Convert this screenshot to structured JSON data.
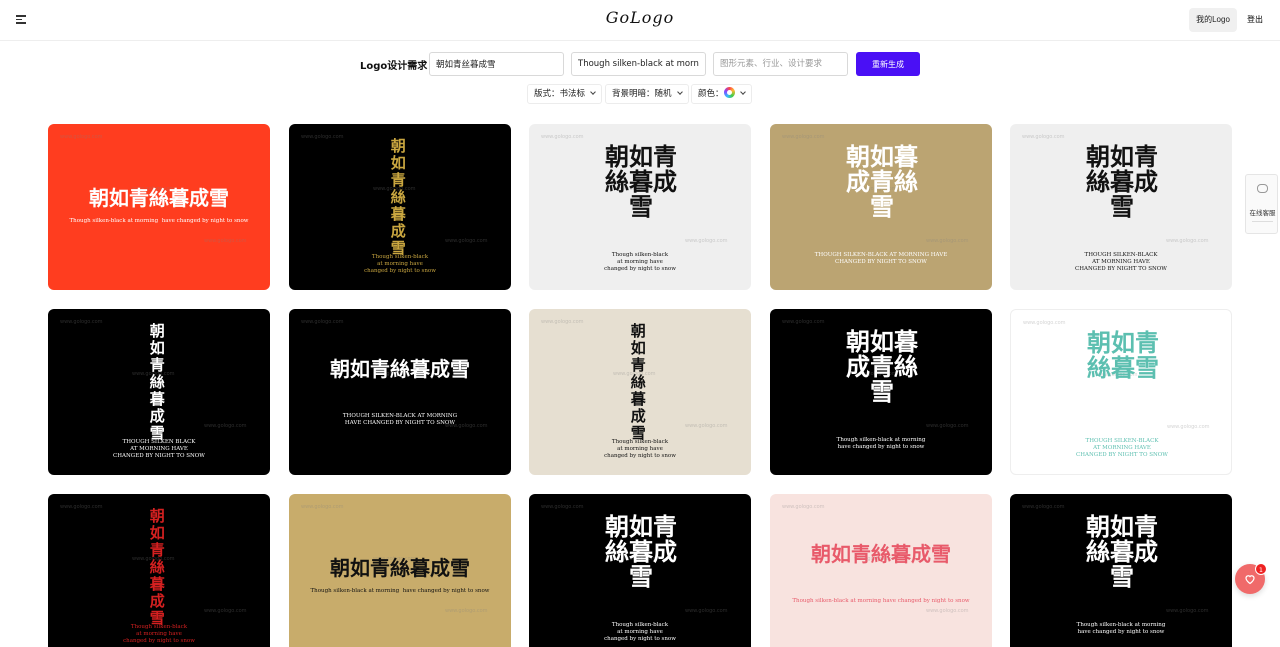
{
  "header": {
    "logo": "GoLogo",
    "my_logo": "我的Logo",
    "logout": "登出"
  },
  "form": {
    "label": "Logo设计需求",
    "name_value": "朝如青丝暮成雪",
    "slogan_value": "Though silken-black at morning h",
    "desc_placeholder": "图形元素、行业、设计要求",
    "regenerate": "重新生成"
  },
  "filters": {
    "layout": "版式：书法标",
    "brightness": "背景明暗：随机",
    "color": "颜色："
  },
  "side_panel": {
    "label": "在线客服"
  },
  "favorites": {
    "count": "1"
  },
  "colors": {
    "accent": "#4a10f5",
    "fav": "#f06a6a"
  },
  "watermark": "www.gologo.com",
  "cards": [
    {
      "bg": "#ff3d1f",
      "fg": "#ffffff",
      "cjk": "朝如青絲暮成雪",
      "eng": "Though silken-black at morning  have changed by night to snow",
      "layout": "h"
    },
    {
      "bg": "#000000",
      "fg": "#c9a640",
      "cjk": "朝如青絲暮成雪",
      "eng": "Though silken-black\nat morning have\nchanged by night to snow",
      "layout": "v"
    },
    {
      "bg": "#efefef",
      "fg": "#111111",
      "cjk": "朝如青絲暮成雪",
      "eng": "Though silken-black\nat morning have\nchanged by night to snow",
      "layout": "b"
    },
    {
      "bg": "#bba472",
      "fg": "#ffffff",
      "cjk": "朝如暮成青絲雪",
      "eng": "THOUGH SILKEN-BLACK AT MORNING HAVE\nCHANGED BY NIGHT TO SNOW",
      "layout": "b"
    },
    {
      "bg": "#efefef",
      "fg": "#111111",
      "cjk": "朝如青絲暮成雪",
      "eng": "THOUGH SILKEN-BLACK\nAT MORNING HAVE\nCHANGED BY NIGHT TO SNOW",
      "layout": "b"
    },
    {
      "bg": "#000000",
      "fg": "#ffffff",
      "cjk": "朝如青絲暮成雪",
      "eng": "THOUGH SILKEN BLACK\nAT MORNING HAVE\nCHANGED BY NIGHT TO SNOW",
      "layout": "v"
    },
    {
      "bg": "#000000",
      "fg": "#ffffff",
      "cjk": "朝如青絲暮成雪",
      "eng": "THOUGH SILKEN-BLACK AT MORNING\nHAVE CHANGED BY NIGHT TO SNOW",
      "layout": "h2"
    },
    {
      "bg": "#e6dfd1",
      "fg": "#111111",
      "cjk": "朝如青絲暮成雪",
      "eng": "Though silken-black\nat morning have\nchanged by night to snow",
      "layout": "v"
    },
    {
      "bg": "#000000",
      "fg": "#ffffff",
      "cjk": "朝如暮成青絲雪",
      "eng": "Though silken-black at morning\nhave changed by night to snow",
      "layout": "b"
    },
    {
      "bg": "#ffffff",
      "fg": "#5cbfb0",
      "cjk": "朝如青絲暮雪",
      "eng": "THOUGH SILKEN-BLACK\nAT MORNING HAVE\nCHANGED BY NIGHT TO SNOW",
      "layout": "b"
    },
    {
      "bg": "#000000",
      "fg": "#d42020",
      "cjk": "朝如青絲暮成雪",
      "eng": "Though silken-black\nat morning have\nchanged by night to snow",
      "layout": "v"
    },
    {
      "bg": "#c8ac6b",
      "fg": "#111111",
      "cjk": "朝如青絲暮成雪",
      "eng": "Though silken-black at morning  have changed by night to snow",
      "layout": "h"
    },
    {
      "bg": "#000000",
      "fg": "#ffffff",
      "cjk": "朝如青絲暮成雪",
      "eng": "Though silken-black\nat morning have\nchanged by night to snow",
      "layout": "b"
    },
    {
      "bg": "#f8e3df",
      "fg": "#e85a6a",
      "cjk": "朝如青絲暮成雪",
      "eng": "Though silken-black at morning have changed by night to snow",
      "layout": "h2"
    },
    {
      "bg": "#000000",
      "fg": "#ffffff",
      "cjk": "朝如青絲暮成雪",
      "eng": "Though silken-black at morning\nhave changed by night to snow",
      "layout": "b"
    }
  ]
}
